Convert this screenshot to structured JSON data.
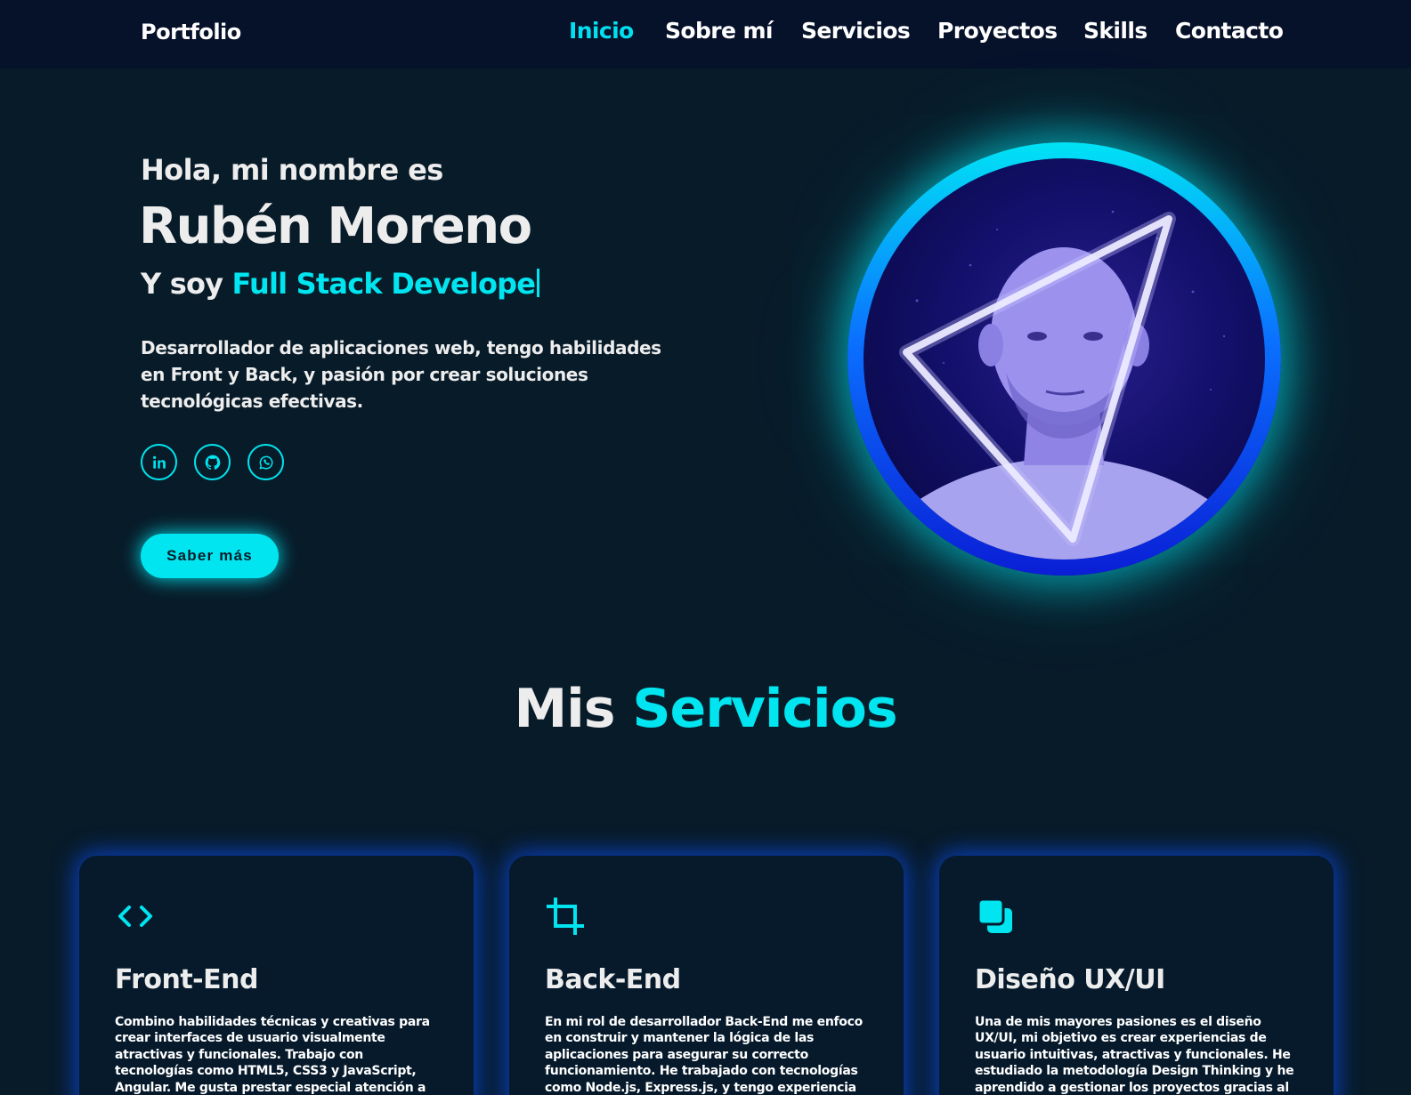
{
  "header": {
    "logo": "Portfolio",
    "nav": [
      {
        "label": "Inicio",
        "active": true
      },
      {
        "label": "Sobre mí",
        "active": false
      },
      {
        "label": "Servicios",
        "active": false
      },
      {
        "label": "Proyectos",
        "active": false
      },
      {
        "label": "Skills",
        "active": false
      },
      {
        "label": "Contacto",
        "active": false
      }
    ]
  },
  "hero": {
    "greeting": "Hola, mi nombre es",
    "name": "Rubén Moreno",
    "role_prefix": "Y soy ",
    "role_text": "Full Stack Develope",
    "description": "Desarrollador de aplicaciones web, tengo habilidades en Front y Back, y pasión por crear soluciones tecnológicas efectivas.",
    "socials": [
      {
        "icon": "linkedin-icon"
      },
      {
        "icon": "github-icon"
      },
      {
        "icon": "whatsapp-icon"
      }
    ],
    "button_label": "Saber más"
  },
  "services": {
    "title_prefix": "Mis ",
    "title_accent": "Servicios",
    "cards": [
      {
        "icon": "code-icon",
        "title": "Front-End",
        "text": "Combino habilidades técnicas y creativas para crear interfaces de usuario visualmente atractivas y funcionales. Trabajo con tecnologías como HTML5, CSS3 y JavaScript, Angular. Me gusta prestar especial atención a los detalles visuales, asegurando que cada"
      },
      {
        "icon": "crop-icon",
        "title": "Back-End",
        "text": "En mi rol de desarrollador Back-End me enfoco en construir y mantener la lógica de las aplicaciones para asegurar su correcto funcionamiento. He trabajado con tecnologías como Node.js, Express.js, y tengo experiencia con bases de datos relacionales y"
      },
      {
        "icon": "layers-icon",
        "title": "Diseño UX/UI",
        "text": "Una de mis mayores pasiones es el diseño UX/UI, mi objetivo es crear experiencias de usuario intuitivas, atractivas y funcionales. He estudiado la metodología Design Thinking y he aprendido a gestionar los proyectos gracias al marco de gestión de Scrum y"
      }
    ]
  },
  "colors": {
    "background": "#081b29",
    "header": "#06112a",
    "accent": "#00e5ef",
    "card_glow": "#0a50ff"
  }
}
